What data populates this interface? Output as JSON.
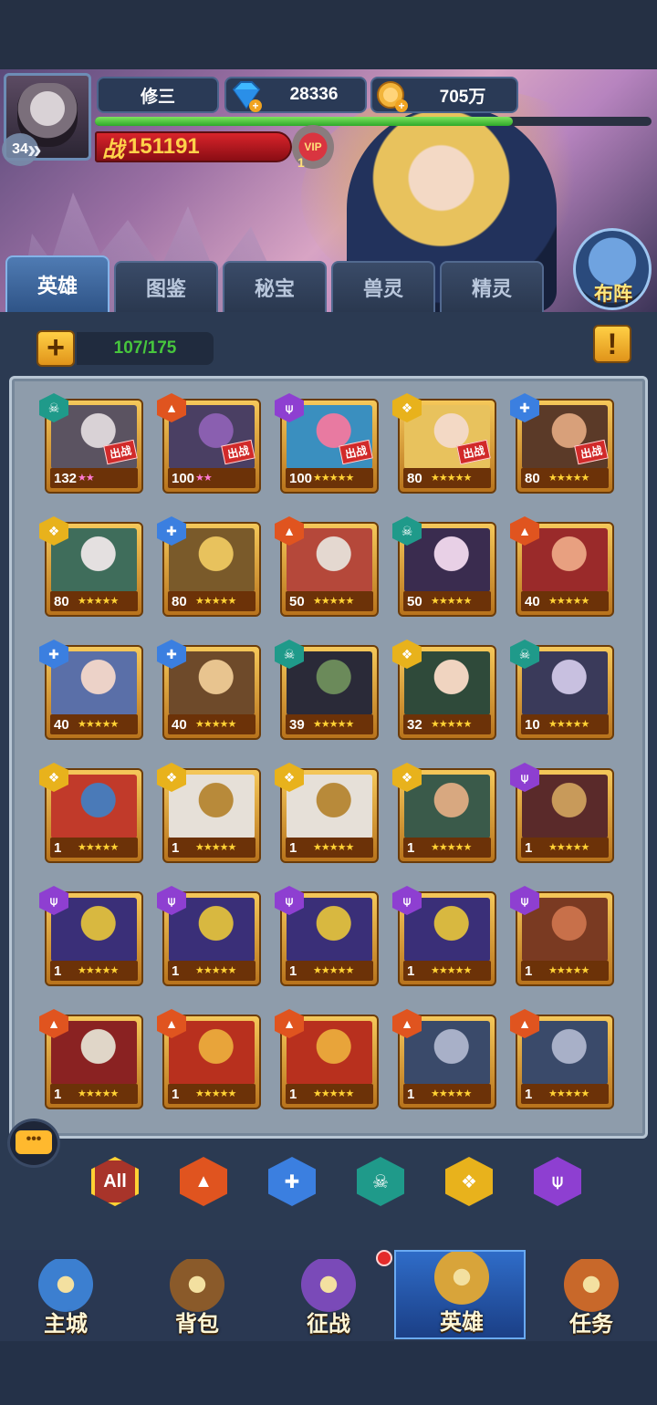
{
  "player": {
    "name": "修三",
    "level": "34",
    "gems": "28336",
    "coins": "705万",
    "power_label": "战",
    "power": "151191",
    "vip_label": "VIP",
    "vip_level": "1",
    "xp_progress": 0.75
  },
  "tabs": [
    "英雄",
    "图鉴",
    "秘宝",
    "兽灵",
    "精灵"
  ],
  "active_tab": 0,
  "formation_label": "布阵",
  "hero_count": "107/175",
  "deploy_badge": "出战",
  "faction_colors": {
    "fire": "#e0541f",
    "water": "#3b7fe0",
    "death": "#1f9a8a",
    "light": "#e8b21c",
    "dark": "#8e3fd1"
  },
  "heroes": [
    {
      "level": "132",
      "faction": "death",
      "stars": "★★",
      "pink": true,
      "deploy": true,
      "portrait": [
        "#5b5361",
        "#d9d2d6"
      ]
    },
    {
      "level": "100",
      "faction": "fire",
      "stars": "★★",
      "pink": true,
      "deploy": true,
      "portrait": [
        "#4a3f63",
        "#8a5fb0"
      ]
    },
    {
      "level": "100",
      "faction": "dark",
      "stars": "★★★★★",
      "pink": false,
      "deploy": true,
      "portrait": [
        "#3a8fbf",
        "#e87aa1"
      ]
    },
    {
      "level": "80",
      "faction": "light",
      "stars": "★★★★★",
      "pink": false,
      "deploy": true,
      "portrait": [
        "#e8c25d",
        "#f3d9c5"
      ]
    },
    {
      "level": "80",
      "faction": "water",
      "stars": "★★★★★",
      "pink": false,
      "deploy": true,
      "portrait": [
        "#5b3a28",
        "#d8a07a"
      ]
    },
    {
      "level": "80",
      "faction": "light",
      "stars": "★★★★★",
      "pink": false,
      "deploy": false,
      "portrait": [
        "#3f6d5b",
        "#e4e0e0"
      ]
    },
    {
      "level": "80",
      "faction": "water",
      "stars": "★★★★★",
      "pink": false,
      "deploy": false,
      "portrait": [
        "#7a5a2a",
        "#e8c25d"
      ]
    },
    {
      "level": "50",
      "faction": "fire",
      "stars": "★★★★★",
      "pink": false,
      "deploy": false,
      "portrait": [
        "#b5483a",
        "#e4d8d0"
      ]
    },
    {
      "level": "50",
      "faction": "death",
      "stars": "★★★★★",
      "pink": false,
      "deploy": false,
      "portrait": [
        "#3a2c4f",
        "#e8d0e6"
      ]
    },
    {
      "level": "40",
      "faction": "fire",
      "stars": "★★★★★",
      "pink": false,
      "deploy": false,
      "portrait": [
        "#9a2a2a",
        "#e8a080"
      ]
    },
    {
      "level": "40",
      "faction": "water",
      "stars": "★★★★★",
      "pink": false,
      "deploy": false,
      "portrait": [
        "#5a6fa8",
        "#ecd2c8"
      ]
    },
    {
      "level": "40",
      "faction": "water",
      "stars": "★★★★★",
      "pink": false,
      "deploy": false,
      "portrait": [
        "#6e4a2a",
        "#e8c48f"
      ]
    },
    {
      "level": "39",
      "faction": "death",
      "stars": "★★★★★",
      "pink": false,
      "deploy": false,
      "portrait": [
        "#2a2a38",
        "#6b8a5a"
      ]
    },
    {
      "level": "32",
      "faction": "light",
      "stars": "★★★★★",
      "pink": false,
      "deploy": false,
      "portrait": [
        "#2f4a3a",
        "#f0d4c0"
      ]
    },
    {
      "level": "10",
      "faction": "death",
      "stars": "★★★★★",
      "pink": false,
      "deploy": false,
      "portrait": [
        "#3a3a5a",
        "#c8c0e0"
      ]
    },
    {
      "level": "1",
      "faction": "light",
      "stars": "★★★★★",
      "pink": false,
      "deploy": false,
      "portrait": [
        "#c13a2a",
        "#4a7ab8"
      ]
    },
    {
      "level": "1",
      "faction": "light",
      "stars": "★★★★★",
      "pink": false,
      "deploy": false,
      "portrait": [
        "#e6e0d8",
        "#b88a3a"
      ]
    },
    {
      "level": "1",
      "faction": "light",
      "stars": "★★★★★",
      "pink": false,
      "deploy": false,
      "portrait": [
        "#e6e0d8",
        "#b88a3a"
      ]
    },
    {
      "level": "1",
      "faction": "light",
      "stars": "★★★★★",
      "pink": false,
      "deploy": false,
      "portrait": [
        "#3a5a4a",
        "#d8a880"
      ]
    },
    {
      "level": "1",
      "faction": "dark",
      "stars": "★★★★★",
      "pink": false,
      "deploy": false,
      "portrait": [
        "#5a2a2a",
        "#c89a5a"
      ]
    },
    {
      "level": "1",
      "faction": "dark",
      "stars": "★★★★★",
      "pink": false,
      "deploy": false,
      "portrait": [
        "#3a2f78",
        "#d8b840"
      ]
    },
    {
      "level": "1",
      "faction": "dark",
      "stars": "★★★★★",
      "pink": false,
      "deploy": false,
      "portrait": [
        "#3a2f78",
        "#d8b840"
      ]
    },
    {
      "level": "1",
      "faction": "dark",
      "stars": "★★★★★",
      "pink": false,
      "deploy": false,
      "portrait": [
        "#3a2f78",
        "#d8b840"
      ]
    },
    {
      "level": "1",
      "faction": "dark",
      "stars": "★★★★★",
      "pink": false,
      "deploy": false,
      "portrait": [
        "#3a2f78",
        "#d8b840"
      ]
    },
    {
      "level": "1",
      "faction": "dark",
      "stars": "★★★★★",
      "pink": false,
      "deploy": false,
      "portrait": [
        "#7a3a22",
        "#c8704a"
      ]
    },
    {
      "level": "1",
      "faction": "fire",
      "stars": "★★★★★",
      "pink": false,
      "deploy": false,
      "portrait": [
        "#8a2222",
        "#e0d6c8"
      ]
    },
    {
      "level": "1",
      "faction": "fire",
      "stars": "★★★★★",
      "pink": false,
      "deploy": false,
      "portrait": [
        "#b8301e",
        "#e8a43a"
      ]
    },
    {
      "level": "1",
      "faction": "fire",
      "stars": "★★★★★",
      "pink": false,
      "deploy": false,
      "portrait": [
        "#b8301e",
        "#e8a43a"
      ]
    },
    {
      "level": "1",
      "faction": "fire",
      "stars": "★★★★★",
      "pink": false,
      "deploy": false,
      "portrait": [
        "#3a4a6a",
        "#a8b0c8"
      ]
    },
    {
      "level": "1",
      "faction": "fire",
      "stars": "★★★★★",
      "pink": false,
      "deploy": false,
      "portrait": [
        "#3a4a6a",
        "#a8b0c8"
      ]
    }
  ],
  "faction_filters": [
    {
      "label": "All",
      "faction": "all",
      "color": "#a8342a"
    },
    {
      "label": "",
      "faction": "fire",
      "color": "#e0541f"
    },
    {
      "label": "",
      "faction": "water",
      "color": "#3b7fe0"
    },
    {
      "label": "",
      "faction": "death",
      "color": "#1f9a8a"
    },
    {
      "label": "",
      "faction": "light",
      "color": "#e8b21c"
    },
    {
      "label": "",
      "faction": "dark",
      "color": "#8e3fd1"
    }
  ],
  "chat_label": "•••",
  "nav": [
    {
      "label": "主城",
      "icon": "castle-icon",
      "color": "#3c7fd0"
    },
    {
      "label": "背包",
      "icon": "chest-icon",
      "color": "#8a5a2a"
    },
    {
      "label": "征战",
      "icon": "portal-icon",
      "color": "#7a4ab8"
    },
    {
      "label": "英雄",
      "icon": "helmet-icon",
      "color": "#d8a43a"
    },
    {
      "label": "任务",
      "icon": "scroll-icon",
      "color": "#c8682a"
    }
  ],
  "active_nav": 3
}
